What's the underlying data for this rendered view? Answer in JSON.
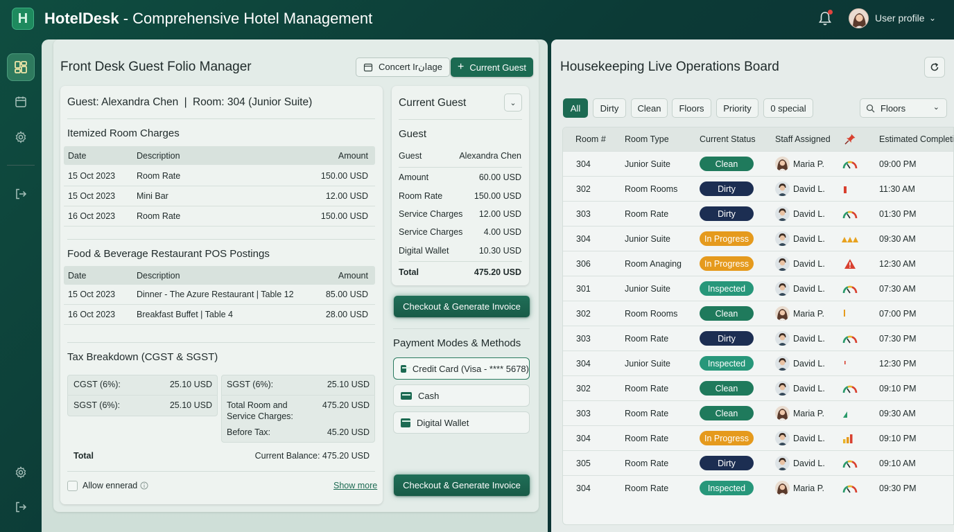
{
  "app": {
    "name": "HotelDesk",
    "subtitle": " - Comprehensive Hotel Management",
    "logo_letter": "H"
  },
  "header": {
    "profile_label": "User profile",
    "notification_dot": true
  },
  "sidebar": {
    "items": [
      {
        "icon": "dashboard-icon",
        "active": true
      },
      {
        "icon": "calendar-icon",
        "active": false
      },
      {
        "icon": "gear-icon",
        "active": false
      },
      {
        "icon": "logout-icon",
        "active": false
      },
      {
        "icon": "gear-icon",
        "active": false
      },
      {
        "icon": "logout-icon",
        "active": false
      }
    ]
  },
  "folio": {
    "title": "Front Desk Guest Folio Manager",
    "btn_concert": "Concert Irانage",
    "btn_current_guest": "Current Guest",
    "guest_line": "Guest: Alexandra Chen",
    "room_line": "Room: 304 (Junior Suite)",
    "room_charges": {
      "heading": "Itemized Room Charges",
      "headers": [
        "Date",
        "Description",
        "Amount"
      ],
      "rows": [
        {
          "date": "15 Oct 2023",
          "desc": "Room Rate",
          "amount": "150.00 USD"
        },
        {
          "date": "15 Oct 2023",
          "desc": "Mini Bar",
          "amount": "12.00 USD"
        },
        {
          "date": "16 Oct 2023",
          "desc": "Room Rate",
          "amount": "150.00 USD"
        }
      ]
    },
    "fnb": {
      "heading": "Food & Beverage Restaurant POS Postings",
      "headers": [
        "Date",
        "Description",
        "Amount"
      ],
      "rows": [
        {
          "date": "15 Oct 2023",
          "desc": "Dinner - The Azure Restaurant | Table 12",
          "amount": "85.00 USD"
        },
        {
          "date": "16 Oct 2023",
          "desc": "Breakfast Buffet | Table 4",
          "amount": "28.00 USD"
        }
      ]
    },
    "tax": {
      "heading": "Tax Breakdown (CGST & SGST)",
      "left": [
        {
          "label": "CGST (6%):",
          "value": "25.10 USD"
        },
        {
          "label": "SGST (6%):",
          "value": "25.10 USD"
        }
      ],
      "right_sgst_label": "SGST (6%):",
      "right_sgst_value": "25.10 USD",
      "right_total_label_1": "Total Room and",
      "right_total_label_2": "Service Charges:",
      "right_total_value": "475.20 USD",
      "right_before_label": "Before Tax:",
      "right_before_value": "45.20 USD",
      "total_label": "Total",
      "balance": "Current Balance: 475.20 USD"
    },
    "allow_label": "Allow ennerad",
    "show_more": "Show more"
  },
  "guest_card": {
    "title": "Current Guest",
    "section": "Guest",
    "rows": [
      {
        "label": "Guest",
        "value": "Alexandra Chen"
      },
      {
        "label": "Amount",
        "value": "60.00 USD"
      },
      {
        "label": "Room Rate",
        "value": "150.00 USD"
      },
      {
        "label": "Service Charges",
        "value": "12.00 USD"
      },
      {
        "label": "Service Charges",
        "value": "4.00 USD"
      },
      {
        "label": "Digital Wallet",
        "value": "10.30 USD"
      }
    ],
    "total_label": "Total",
    "total_value": "475.20 USD",
    "checkout_label": "Checkout & Generate Invoice"
  },
  "payment": {
    "heading": "Payment Modes & Methods",
    "methods": [
      "Credit Card (Visa - **** 5678)",
      "Cash",
      "Digital Wallet"
    ],
    "checkout_label": "Checkout & Generate Invoice"
  },
  "housekeeping": {
    "title": "Housekeeping Live Operations Board",
    "filters": [
      "All",
      "Dirty",
      "Clean",
      "Floors",
      "Priority",
      "0 special"
    ],
    "select_label": "Floors",
    "headers": [
      "Room #",
      "Room Type",
      "Current Status",
      "Staff Assigned",
      "Estimated Completio"
    ],
    "rows": [
      {
        "room": "304",
        "type": "Junior Suite",
        "status": "Clean",
        "staff": "Maria P.",
        "staff_gender": "f",
        "prio": "gauge",
        "time": "09:00 PM"
      },
      {
        "room": "302",
        "type": "Room Rooms",
        "status": "Dirty",
        "staff": "David L.",
        "staff_gender": "m",
        "prio": "red-bar",
        "time": "11:30 AM"
      },
      {
        "room": "303",
        "type": "Room Rate",
        "status": "Dirty",
        "staff": "David L.",
        "staff_gender": "m",
        "prio": "gauge",
        "time": "01:30 PM"
      },
      {
        "room": "304",
        "type": "Junior Suite",
        "status": "In Progress",
        "staff": "David L.",
        "staff_gender": "m",
        "prio": "triple-warning",
        "time": "09:30 AM"
      },
      {
        "room": "306",
        "type": "Room Anaging",
        "status": "In Progress",
        "staff": "David L.",
        "staff_gender": "m",
        "prio": "warning",
        "time": "12:30 AM"
      },
      {
        "room": "301",
        "type": "Junior Suite",
        "status": "Inspected",
        "staff": "David L.",
        "staff_gender": "m",
        "prio": "gauge",
        "time": "07:30 AM"
      },
      {
        "room": "302",
        "type": "Room Rooms",
        "status": "Clean",
        "staff": "Maria P.",
        "staff_gender": "f",
        "prio": "orange-bar",
        "time": "07:00 PM"
      },
      {
        "room": "303",
        "type": "Room Rate",
        "status": "Dirty",
        "staff": "David L.",
        "staff_gender": "m",
        "prio": "gauge",
        "time": "07:30 PM"
      },
      {
        "room": "304",
        "type": "Junior Suite",
        "status": "Inspected",
        "staff": "David L.",
        "staff_gender": "m",
        "prio": "red-tick",
        "time": "12:30 PM"
      },
      {
        "room": "302",
        "type": "Room Rate",
        "status": "Clean",
        "staff": "David L.",
        "staff_gender": "m",
        "prio": "gauge",
        "time": "09:10 PM"
      },
      {
        "room": "303",
        "type": "Room Rate",
        "status": "Clean",
        "staff": "Maria P.",
        "staff_gender": "f",
        "prio": "green-bar",
        "time": "09:30 AM"
      },
      {
        "room": "304",
        "type": "Room Rate",
        "status": "In Progress",
        "staff": "David L.",
        "staff_gender": "m",
        "prio": "bars",
        "time": "09:10 PM"
      },
      {
        "room": "305",
        "type": "Room Rate",
        "status": "Dirty",
        "staff": "David L.",
        "staff_gender": "m",
        "prio": "gauge",
        "time": "09:10 AM"
      },
      {
        "room": "304",
        "type": "Room Rate",
        "status": "Inspected",
        "staff": "Maria P.",
        "staff_gender": "f",
        "prio": "gauge",
        "time": "09:30 PM"
      }
    ]
  }
}
